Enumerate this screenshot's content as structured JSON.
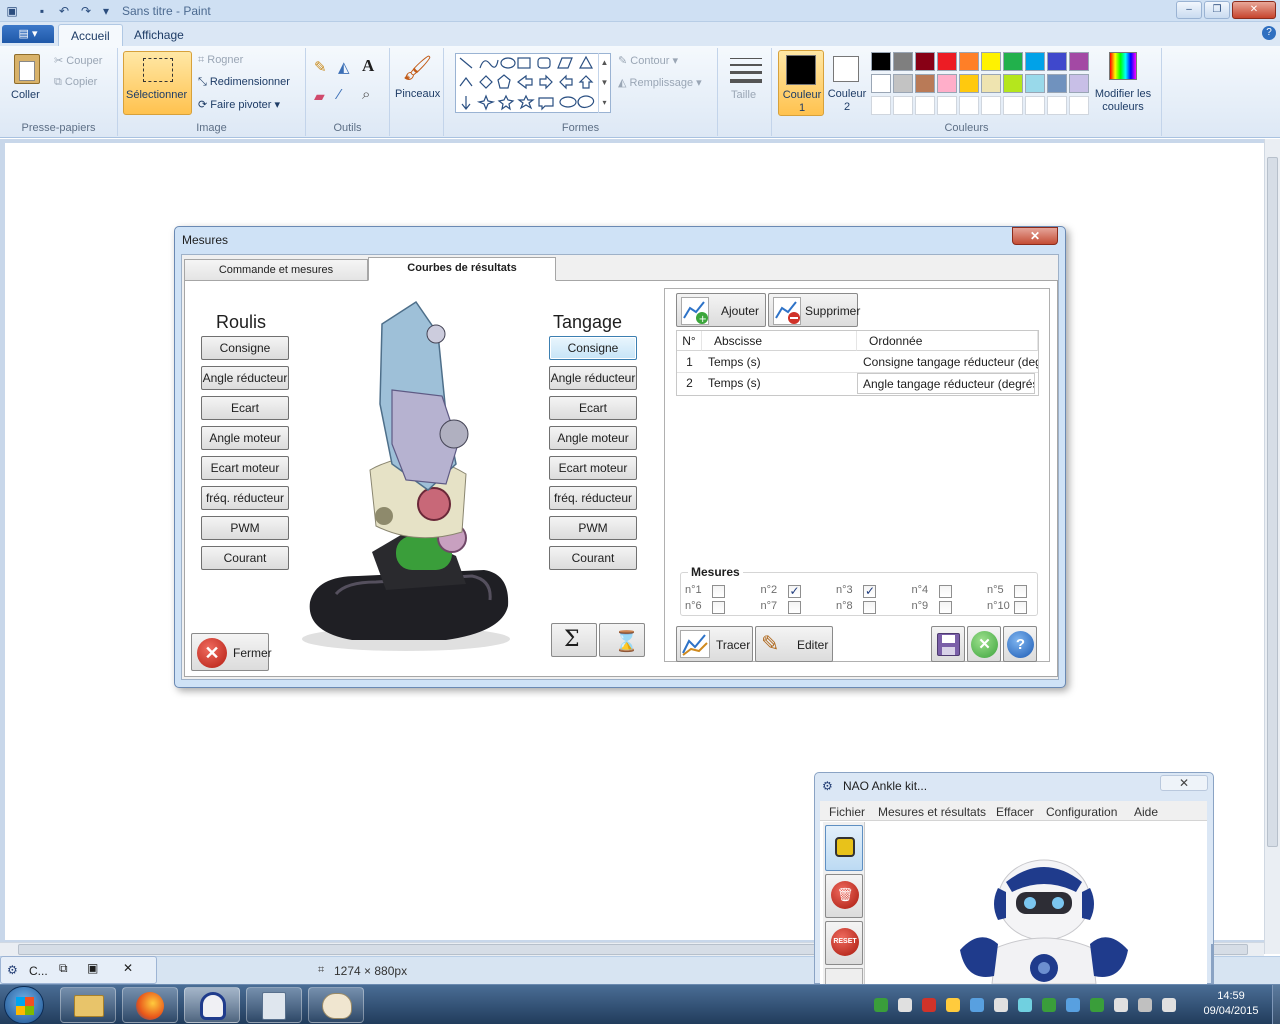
{
  "window": {
    "title": "Sans titre - Paint",
    "min": "‒",
    "max": "❐",
    "close": "✕"
  },
  "ribbon": {
    "file_btn": "▤ ▾",
    "tabs": [
      "Accueil",
      "Affichage"
    ],
    "clipboard": {
      "paste": "Coller",
      "cut": "Couper",
      "copy": "Copier",
      "label": "Presse-papiers"
    },
    "image": {
      "select": "Sélectionner",
      "crop": "Rogner",
      "resize": "Redimensionner",
      "rotate": "Faire pivoter ▾",
      "label": "Image"
    },
    "tools": {
      "label": "Outils"
    },
    "brushes": {
      "label": "Pinceaux"
    },
    "shapes": {
      "outline": "Contour ▾",
      "fill": "Remplissage ▾",
      "label": "Formes"
    },
    "size": {
      "label": "Taille"
    },
    "colors": {
      "color1": "Couleur 1",
      "color2": "Couleur 2",
      "edit": "Modifier les couleurs",
      "label": "Couleurs",
      "palette_row1": [
        "#000000",
        "#7f7f7f",
        "#880015",
        "#ed1c24",
        "#ff7f27",
        "#fff200",
        "#22b14c",
        "#00a2e8",
        "#3f48cc",
        "#a349a4"
      ],
      "palette_row2": [
        "#ffffff",
        "#c3c3c3",
        "#b97a57",
        "#ffaec9",
        "#ffc90e",
        "#efe4b0",
        "#b5e61d",
        "#99d9ea",
        "#7092be",
        "#c8bfe7"
      ]
    }
  },
  "status": {
    "dimensions": "1274 × 880px"
  },
  "dialog": {
    "title": "Mesures",
    "close": "✕",
    "tabs": [
      "Commande et mesures",
      "Courbes de résultats"
    ],
    "roulis": {
      "header": "Roulis",
      "buttons": [
        "Consigne",
        "Angle réducteur",
        "Ecart",
        "Angle moteur",
        "Ecart moteur",
        "fréq. réducteur",
        "PWM",
        "Courant"
      ]
    },
    "tangage": {
      "header": "Tangage",
      "buttons": [
        "Consigne",
        "Angle réducteur",
        "Ecart",
        "Angle moteur",
        "Ecart moteur",
        "fréq. réducteur",
        "PWM",
        "Courant"
      ]
    },
    "close_btn": "Fermer",
    "add_btn": "Ajouter",
    "remove_btn": "Supprimer",
    "grid": {
      "headers": [
        "N°",
        "Abscisse",
        "Ordonnée"
      ],
      "rows": [
        {
          "n": "1",
          "x": "Temps (s)",
          "y": "Consigne tangage réducteur (degrés)"
        },
        {
          "n": "2",
          "x": "Temps (s)",
          "y": "Angle tangage réducteur (degrés)"
        }
      ]
    },
    "mesures": {
      "label": "Mesures",
      "items": [
        {
          "label": "n°1",
          "checked": false
        },
        {
          "label": "n°2",
          "checked": true
        },
        {
          "label": "n°3",
          "checked": true
        },
        {
          "label": "n°4",
          "checked": false
        },
        {
          "label": "n°5",
          "checked": false
        },
        {
          "label": "n°6",
          "checked": false
        },
        {
          "label": "n°7",
          "checked": false
        },
        {
          "label": "n°8",
          "checked": false
        },
        {
          "label": "n°9",
          "checked": false
        },
        {
          "label": "n°10",
          "checked": false
        }
      ]
    },
    "trace_btn": "Tracer",
    "edit_btn": "Editer"
  },
  "nao": {
    "title": "NAO Ankle kit...",
    "close": "✕",
    "menu": [
      "Fichier",
      "Mesures et résultats",
      "Effacer",
      "Configuration",
      "Aide"
    ],
    "reset": "RESET"
  },
  "taskbar": {
    "preview_title": "C...",
    "time": "14:59",
    "date": "09/04/2015"
  }
}
